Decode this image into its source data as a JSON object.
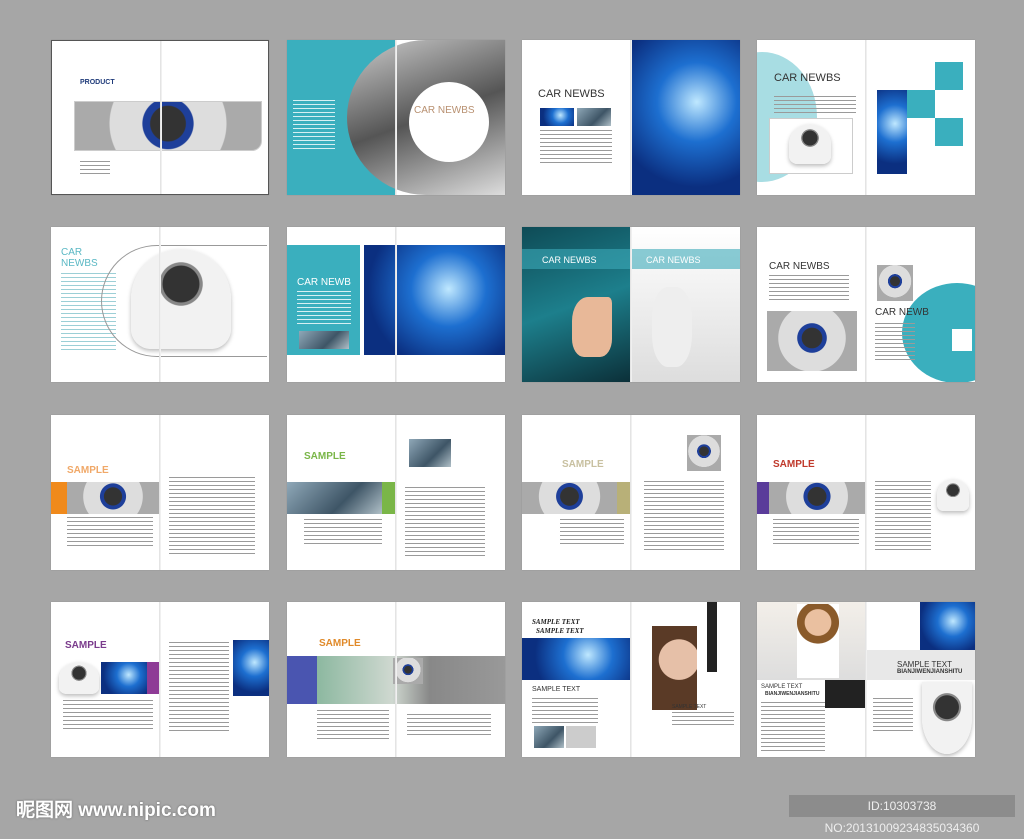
{
  "spreads": {
    "cover_title": "PRODUCT",
    "car_newbs": "CAR NEWBS",
    "car_newb": "CAR NEWB",
    "sample": "SAMPLE",
    "sample_text": "SAMPLE TEXT",
    "bianji": "BIANJIWENJIANSHITU",
    "sample_colors": [
      "#f0a868",
      "#7ab648",
      "#c8c0a0",
      "#c0392b",
      "#7a3b8c",
      "#e08a2a"
    ],
    "bar_colors": [
      "#f08a1c",
      "#7ab648",
      "#b8b078",
      "#5a3c9a",
      "#8e3b96",
      "#4a55b0"
    ],
    "accent": "#3aafbe"
  },
  "watermark": {
    "site": "昵图网 www.nipic.com",
    "id": "ID:10303738 NO:20131009234835034360"
  }
}
